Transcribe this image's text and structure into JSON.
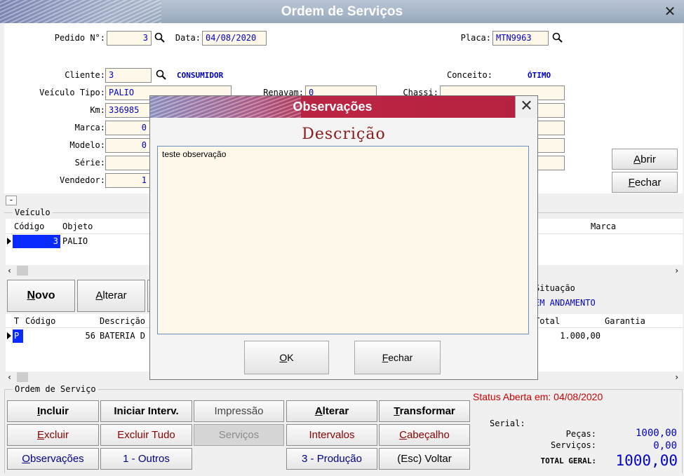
{
  "window": {
    "title": "Ordem de Serviços",
    "close_glyph": "✕"
  },
  "header": {
    "pedido_label": "Pedido N°:",
    "pedido_value": "3",
    "data_label": "Data:",
    "data_value": "04/08/2020",
    "placa_label": "Placa:",
    "placa_value": "MTN9963",
    "cliente_label": "Cliente:",
    "cliente_value": "3",
    "cliente_nome": "CONSUMIDOR",
    "conceito_label": "Conceito:",
    "conceito_value": "ÓTIMO",
    "veiculo_tipo_label": "Veículo Tipo:",
    "veiculo_tipo_value": "PALIO",
    "renavam_label": "Renavam:",
    "renavam_value": "0",
    "chassi_label": "Chassi:",
    "km_label": "Km:",
    "km_value": "336985",
    "marca_label": "Marca:",
    "marca_value": "0",
    "modelo_label": "Modelo:",
    "modelo_value": "0",
    "serie_label": "Série:",
    "vendedor_label": "Vendedor:",
    "vendedor_value": "1",
    "abrir_button": "Abrir",
    "fechar_button": "Fechar"
  },
  "collapse_label": "-",
  "veiculo_grid": {
    "legend": "Veículo",
    "columns": [
      "Código",
      "Objeto",
      "Marca"
    ],
    "row": {
      "codigo": "3",
      "objeto": "PALIO"
    }
  },
  "mid_buttons": {
    "novo": "Novo",
    "alterar": "Alterar"
  },
  "situacao": {
    "label": "Situação",
    "value": "EM ANDAMENTO"
  },
  "items_grid": {
    "columns": [
      "T",
      "Código",
      "Descrição",
      "Total",
      "Garantia"
    ],
    "row": {
      "tipo": "P",
      "codigo": "56",
      "descricao": "BATERIA D",
      "total": "1.000,00"
    }
  },
  "ordem": {
    "legend": "Ordem de Serviço",
    "status": "Status Aberta em: 04/08/2020",
    "buttons": {
      "incluir": "Incluir",
      "iniciar": "Iniciar Interv.",
      "impressao": "Impressão",
      "alterar": "Alterar",
      "transformar": "Transformar",
      "excluir": "Excluir",
      "excluir_tudo": "Excluir Tudo",
      "servicos": "Serviços",
      "intervalos": "Intervalos",
      "cabecalho": "Cabeçalho",
      "observacoes": "Observações",
      "outros": "1 - Outros",
      "producao": "3 - Produção",
      "voltar": "(Esc) Voltar"
    }
  },
  "totals": {
    "serial_label": "Serial:",
    "pecas_label": "Peças:",
    "pecas_value": "1000,00",
    "servicos_label": "Serviços:",
    "servicos_value": "0,00",
    "total_label": "TOTAL GERAL:",
    "total_value": "1000,00"
  },
  "modal": {
    "title": "Observações",
    "close_glyph": "✕",
    "heading": "Descrição",
    "text": "teste observação",
    "ok_button": "OK",
    "fechar_button": "Fechar"
  },
  "colors": {
    "field_bg": "#fdf8e9",
    "field_text": "#0000c8",
    "modal_title_bg": "#bc2443",
    "heading_red": "#8b1a1a",
    "status_red": "#cc0000"
  }
}
